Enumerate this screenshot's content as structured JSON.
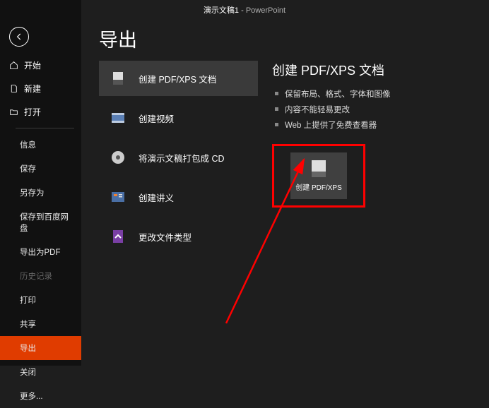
{
  "titlebar": {
    "doc": "演示文稿1",
    "sep": "  -  ",
    "app": "PowerPoint"
  },
  "sidebar": {
    "primary": [
      {
        "name": "home",
        "label": "开始"
      },
      {
        "name": "new",
        "label": "新建"
      },
      {
        "name": "open",
        "label": "打开"
      }
    ],
    "secondary": [
      {
        "name": "info",
        "label": "信息"
      },
      {
        "name": "save",
        "label": "保存"
      },
      {
        "name": "saveas",
        "label": "另存为"
      },
      {
        "name": "save-baidu",
        "label": "保存到百度网盘"
      },
      {
        "name": "export-pdf",
        "label": "导出为PDF"
      },
      {
        "name": "history",
        "label": "历史记录",
        "disabled": true
      },
      {
        "name": "print",
        "label": "打印"
      },
      {
        "name": "share",
        "label": "共享"
      },
      {
        "name": "export",
        "label": "导出",
        "active": true
      },
      {
        "name": "close",
        "label": "关闭"
      },
      {
        "name": "more",
        "label": "更多..."
      }
    ]
  },
  "page": {
    "title": "导出",
    "options": [
      {
        "name": "create-pdf-xps",
        "label": "创建 PDF/XPS 文档",
        "active": true,
        "icon": "pdf"
      },
      {
        "name": "create-video",
        "label": "创建视频",
        "icon": "video"
      },
      {
        "name": "package-cd",
        "label": "将演示文稿打包成 CD",
        "icon": "cd"
      },
      {
        "name": "create-handouts",
        "label": "创建讲义",
        "icon": "handout"
      },
      {
        "name": "change-file-type",
        "label": "更改文件类型",
        "icon": "filetype"
      }
    ],
    "detail": {
      "title": "创建 PDF/XPS 文档",
      "bullets": [
        "保留布局、格式、字体和图像",
        "内容不能轻易更改",
        "Web 上提供了免费查看器"
      ],
      "action_label": "创建 PDF/XPS"
    }
  }
}
